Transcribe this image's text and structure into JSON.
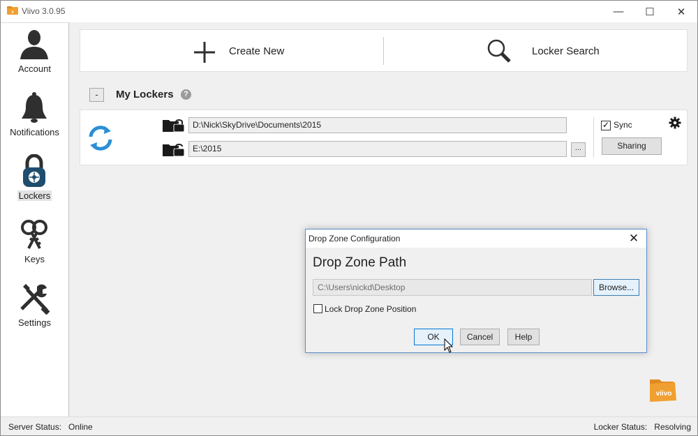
{
  "window": {
    "title": "Viivo 3.0.95",
    "minimize_glyph": "—",
    "maximize_glyph": "☐",
    "close_glyph": "✕"
  },
  "sidebar": {
    "items": [
      {
        "label": "Account",
        "icon": "user-silhouette-icon"
      },
      {
        "label": "Notifications",
        "icon": "bell-icon"
      },
      {
        "label": "Lockers",
        "icon": "padlock-icon",
        "active": true
      },
      {
        "label": "Keys",
        "icon": "keys-icon"
      },
      {
        "label": "Settings",
        "icon": "wrench-screwdriver-icon"
      }
    ]
  },
  "actions": {
    "create_new": "Create New",
    "locker_search": "Locker Search"
  },
  "lockers": {
    "collapse_label": "-",
    "title": "My Lockers",
    "help_glyph": "?",
    "rows": [
      {
        "cloud_path": "D:\\Nick\\SkyDrive\\Documents\\2015",
        "local_path": "E:\\2015",
        "browse_label": "...",
        "sync_checked": true,
        "sync_label": "Sync",
        "sharing_label": "Sharing"
      }
    ]
  },
  "status": {
    "server_label": "Server Status:",
    "server_value": "Online",
    "locker_label": "Locker Status:",
    "locker_value": "Resolving"
  },
  "dialog": {
    "title": "Drop Zone Configuration",
    "close_glyph": "✕",
    "heading": "Drop Zone Path",
    "path_value": "C:\\Users\\nickd\\Desktop",
    "browse_label": "Browse...",
    "lock_label": "Lock Drop Zone Position",
    "lock_checked": false,
    "ok_label": "OK",
    "cancel_label": "Cancel",
    "help_label": "Help"
  },
  "colors": {
    "accent_blue": "#2a8fd6",
    "icon_dark": "#2f2f2f",
    "logo_orange": "#f0a030"
  }
}
